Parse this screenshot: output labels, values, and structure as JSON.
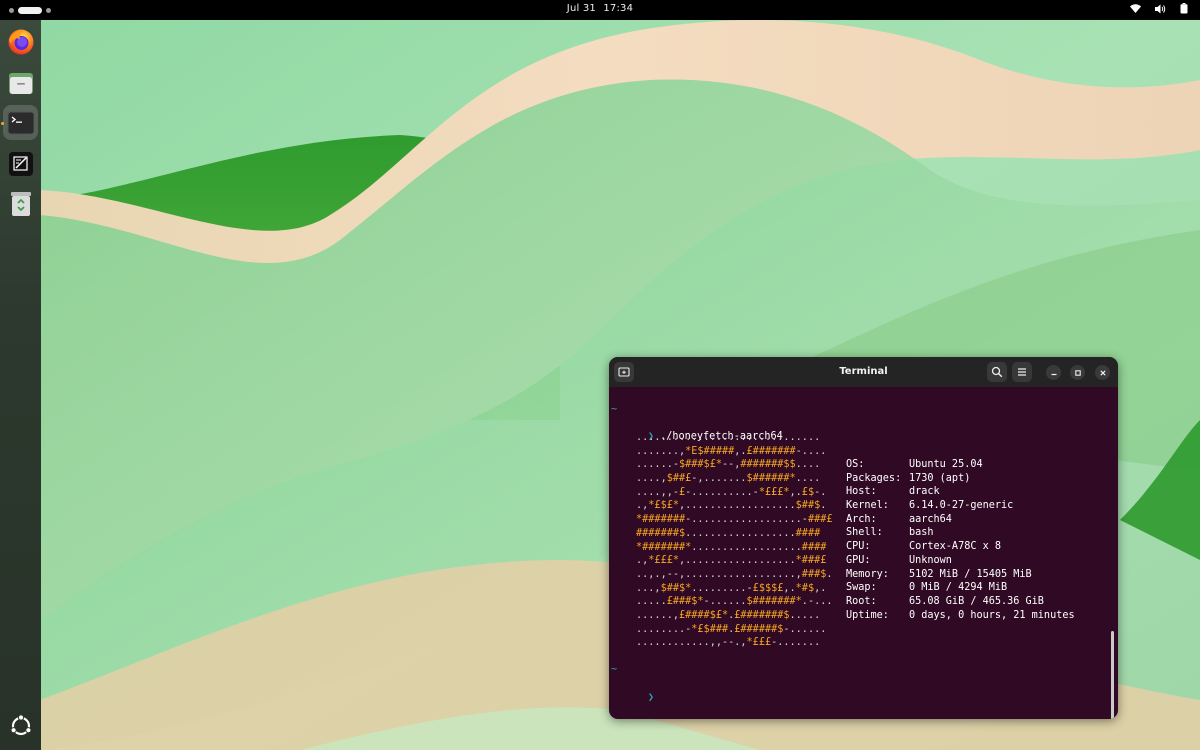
{
  "topbar": {
    "date": "Jul 31",
    "time": "17:34",
    "tray_icons": [
      "wifi-icon",
      "speaker-icon",
      "battery-icon"
    ]
  },
  "dock": {
    "items": [
      {
        "name": "firefox-icon",
        "running": false
      },
      {
        "name": "files-icon",
        "running": false
      },
      {
        "name": "terminal-icon",
        "running": true
      },
      {
        "name": "text-editor-icon",
        "running": false
      },
      {
        "name": "trash-icon",
        "running": false
      },
      {
        "name": "show-apps-icon",
        "running": false
      }
    ]
  },
  "terminal": {
    "title": "Terminal",
    "prompt_symbol": "❯",
    "tilde": "~",
    "command": "./honeyfetch-aarch64",
    "logo_lines": [
      "..............................",
      ".......,*E$#####,.£#######-....",
      "......-$###$£*--,#######$$....",
      "....,$##£-,.......$######*....",
      "....,,-£-..........-*£££*,.£$-.",
      ".,*£$£*,..................$##$.",
      "*#######-..................-###£",
      "#######$..................####",
      "*#######*..................####",
      ".,*£££*,..................*###£",
      "..,.,--,..................,###$.",
      "...,$##$*.........-£$$$£,.*#$,.",
      ".....£###$*-......$#######*.-...",
      "......,£####$£*.£#######$.....",
      "........-*£$###.£######$-......",
      "............,,--.,*£££-......."
    ],
    "info": [
      {
        "key": "OS:",
        "value": "Ubuntu 25.04"
      },
      {
        "key": "Packages:",
        "value": "1730 (apt)"
      },
      {
        "key": "Host:",
        "value": "drack"
      },
      {
        "key": "Kernel:",
        "value": "6.14.0-27-generic"
      },
      {
        "key": "Arch:",
        "value": "aarch64"
      },
      {
        "key": "Shell:",
        "value": "bash"
      },
      {
        "key": "CPU:",
        "value": "Cortex-A78C x 8"
      },
      {
        "key": "GPU:",
        "value": "Unknown"
      },
      {
        "key": "Memory:",
        "value": "5102 MiB / 15405 MiB"
      },
      {
        "key": "Swap:",
        "value": "0 MiB / 4294 MiB"
      },
      {
        "key": "Root:",
        "value": "65.08 GiB / 465.36 GiB"
      },
      {
        "key": "Uptime:",
        "value": "0 days, 0 hours, 21 minutes"
      }
    ]
  },
  "colors": {
    "terminal_bg": "#300a24",
    "prompt": "#2aa1b3",
    "logo": "#f5a623",
    "titlebar": "#242424"
  }
}
